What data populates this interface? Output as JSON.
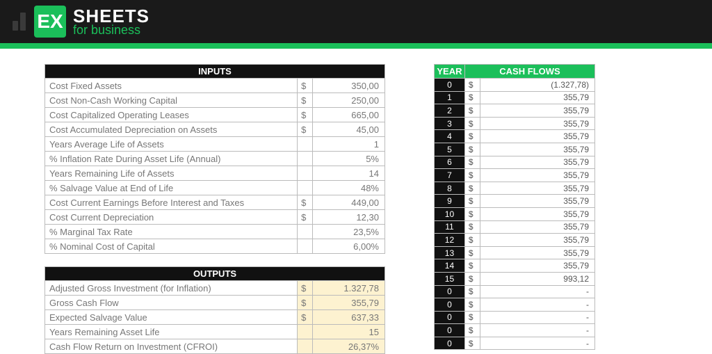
{
  "brand": {
    "ex": "EX",
    "title": "SHEETS",
    "sub": "for business"
  },
  "inputs": {
    "header": "INPUTS",
    "rows": [
      {
        "label": "Cost Fixed Assets",
        "sym": "$",
        "val": "350,00"
      },
      {
        "label": "Cost Non-Cash Working Capital",
        "sym": "$",
        "val": "250,00"
      },
      {
        "label": "Cost Capitalized Operating Leases",
        "sym": "$",
        "val": "665,00"
      },
      {
        "label": "Cost Accumulated Depreciation on Assets",
        "sym": "$",
        "val": "45,00"
      },
      {
        "label": "Years Average Life of Assets",
        "sym": "",
        "val": "1"
      },
      {
        "label": "% Inflation Rate During Asset Life (Annual)",
        "sym": "",
        "val": "5%"
      },
      {
        "label": "Years Remaining Life of Assets",
        "sym": "",
        "val": "14"
      },
      {
        "label": "% Salvage Value at End of Life",
        "sym": "",
        "val": "48%"
      },
      {
        "label": "Cost Current Earnings Before Interest and Taxes",
        "sym": "$",
        "val": "449,00"
      },
      {
        "label": "Cost Current Depreciation",
        "sym": "$",
        "val": "12,30"
      },
      {
        "label": "% Marginal Tax Rate",
        "sym": "",
        "val": "23,5%"
      },
      {
        "label": "% Nominal Cost of Capital",
        "sym": "",
        "val": "6,00%"
      }
    ]
  },
  "outputs": {
    "header": "OUTPUTS",
    "rows": [
      {
        "label": "Adjusted Gross Investment (for Inflation)",
        "sym": "$",
        "val": "1.327,78"
      },
      {
        "label": "Gross Cash Flow",
        "sym": "$",
        "val": "355,79"
      },
      {
        "label": "Expected Salvage Value",
        "sym": "$",
        "val": "637,33"
      },
      {
        "label": "Years Remaining Asset Life",
        "sym": "",
        "val": "15"
      },
      {
        "label": "Cash Flow Return on Investment (CFROI)",
        "sym": "",
        "val": "26,37%"
      }
    ]
  },
  "cashflows": {
    "h_year": "YEAR",
    "h_cf": "CASH FLOWS",
    "rows": [
      {
        "yr": "0",
        "sym": "$",
        "amt": "(1.327,78)"
      },
      {
        "yr": "1",
        "sym": "$",
        "amt": "355,79"
      },
      {
        "yr": "2",
        "sym": "$",
        "amt": "355,79"
      },
      {
        "yr": "3",
        "sym": "$",
        "amt": "355,79"
      },
      {
        "yr": "4",
        "sym": "$",
        "amt": "355,79"
      },
      {
        "yr": "5",
        "sym": "$",
        "amt": "355,79"
      },
      {
        "yr": "6",
        "sym": "$",
        "amt": "355,79"
      },
      {
        "yr": "7",
        "sym": "$",
        "amt": "355,79"
      },
      {
        "yr": "8",
        "sym": "$",
        "amt": "355,79"
      },
      {
        "yr": "9",
        "sym": "$",
        "amt": "355,79"
      },
      {
        "yr": "10",
        "sym": "$",
        "amt": "355,79"
      },
      {
        "yr": "11",
        "sym": "$",
        "amt": "355,79"
      },
      {
        "yr": "12",
        "sym": "$",
        "amt": "355,79"
      },
      {
        "yr": "13",
        "sym": "$",
        "amt": "355,79"
      },
      {
        "yr": "14",
        "sym": "$",
        "amt": "355,79"
      },
      {
        "yr": "15",
        "sym": "$",
        "amt": "993,12"
      },
      {
        "yr": "0",
        "sym": "$",
        "amt": "-"
      },
      {
        "yr": "0",
        "sym": "$",
        "amt": "-"
      },
      {
        "yr": "0",
        "sym": "$",
        "amt": "-"
      },
      {
        "yr": "0",
        "sym": "$",
        "amt": "-"
      },
      {
        "yr": "0",
        "sym": "$",
        "amt": "-"
      }
    ]
  }
}
